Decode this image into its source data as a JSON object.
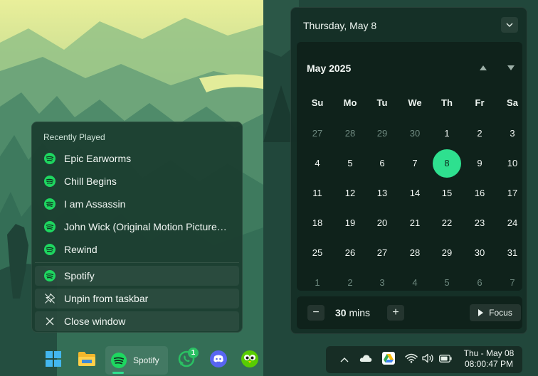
{
  "jumplist": {
    "header": "Recently Played",
    "recent": [
      {
        "label": "Epic Earworms",
        "icon": "spotify-icon"
      },
      {
        "label": "Chill Begins",
        "icon": "spotify-icon"
      },
      {
        "label": "I am Assassin",
        "icon": "spotify-icon"
      },
      {
        "label": "John Wick (Original Motion Picture Soundtrack)",
        "icon": "spotify-icon"
      },
      {
        "label": "Rewind",
        "icon": "spotify-icon"
      }
    ],
    "actions": [
      {
        "label": "Spotify",
        "icon": "spotify-icon"
      },
      {
        "label": "Unpin from taskbar",
        "icon": "unpin-icon"
      },
      {
        "label": "Close window",
        "icon": "close-icon"
      }
    ]
  },
  "calendar": {
    "header_date": "Thursday, May 8",
    "month_label": "May 2025",
    "weekdays": [
      "Su",
      "Mo",
      "Tu",
      "We",
      "Th",
      "Fr",
      "Sa"
    ],
    "weeks": [
      [
        {
          "d": "27",
          "o": true
        },
        {
          "d": "28",
          "o": true
        },
        {
          "d": "29",
          "o": true
        },
        {
          "d": "30",
          "o": true
        },
        {
          "d": "1"
        },
        {
          "d": "2"
        },
        {
          "d": "3"
        }
      ],
      [
        {
          "d": "4"
        },
        {
          "d": "5"
        },
        {
          "d": "6"
        },
        {
          "d": "7"
        },
        {
          "d": "8",
          "today": true
        },
        {
          "d": "9"
        },
        {
          "d": "10"
        }
      ],
      [
        {
          "d": "11"
        },
        {
          "d": "12"
        },
        {
          "d": "13"
        },
        {
          "d": "14"
        },
        {
          "d": "15"
        },
        {
          "d": "16"
        },
        {
          "d": "17"
        }
      ],
      [
        {
          "d": "18"
        },
        {
          "d": "19"
        },
        {
          "d": "20"
        },
        {
          "d": "21"
        },
        {
          "d": "22"
        },
        {
          "d": "23"
        },
        {
          "d": "24"
        }
      ],
      [
        {
          "d": "25"
        },
        {
          "d": "26"
        },
        {
          "d": "27"
        },
        {
          "d": "28"
        },
        {
          "d": "29"
        },
        {
          "d": "30"
        },
        {
          "d": "31"
        }
      ],
      [
        {
          "d": "1",
          "o": true
        },
        {
          "d": "2",
          "o": true
        },
        {
          "d": "3",
          "o": true
        },
        {
          "d": "4",
          "o": true
        },
        {
          "d": "5",
          "o": true
        },
        {
          "d": "6",
          "o": true
        },
        {
          "d": "7",
          "o": true
        }
      ]
    ],
    "focus": {
      "minus": "−",
      "plus": "+",
      "duration_value": "30",
      "duration_unit": "mins",
      "focus_label": "Focus"
    }
  },
  "taskbar": {
    "spotify_label": "Spotify",
    "whatsapp_badge": "1",
    "clock_date": "Thu - May 08",
    "clock_time": "08:00:47 PM"
  },
  "colors": {
    "accent": "#2ee08f",
    "spotify": "#1ed760"
  }
}
